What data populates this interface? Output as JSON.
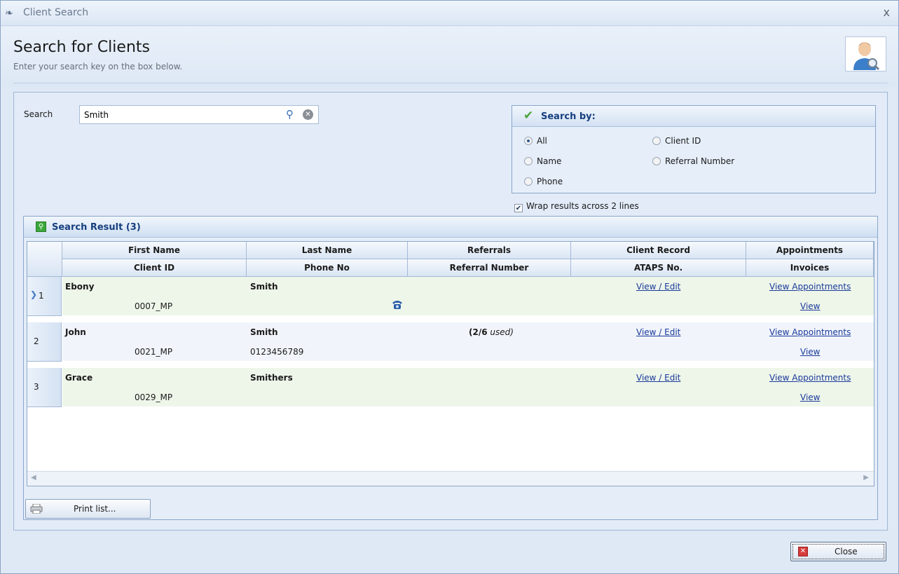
{
  "window": {
    "title": "Client Search",
    "close_glyph": "x"
  },
  "header": {
    "title": "Search for Clients",
    "subtitle": "Enter your search key on the box below."
  },
  "search": {
    "label": "Search",
    "value": "Smith"
  },
  "search_by": {
    "title": "Search by:",
    "options": [
      {
        "label": "All",
        "selected": true
      },
      {
        "label": "Client ID",
        "selected": false
      },
      {
        "label": "Name",
        "selected": false
      },
      {
        "label": "Referral Number",
        "selected": false
      },
      {
        "label": "Phone",
        "selected": false
      }
    ]
  },
  "wrap_option": {
    "label": "Wrap results across 2 lines",
    "checked": true
  },
  "results": {
    "title": "Search Result (3)",
    "columns_top": [
      "First Name",
      "Last Name",
      "Referrals",
      "Client Record",
      "Appointments"
    ],
    "columns_bottom": [
      "Client ID",
      "Phone No",
      "Referral Number",
      "ATAPS No.",
      "Invoices"
    ],
    "rows": [
      {
        "index": "1",
        "first_name": "Ebony",
        "last_name": "Smith",
        "referrals_count": "",
        "referrals_note": "",
        "client_id": "0007_MP",
        "phone": "",
        "client_record": "View / Edit",
        "appointments": "View Appointments",
        "invoices": "View"
      },
      {
        "index": "2",
        "first_name": "John",
        "last_name": "Smith",
        "referrals_count": "(2/6",
        "referrals_note": "used)",
        "client_id": "0021_MP",
        "phone": "0123456789",
        "client_record": "View / Edit",
        "appointments": "View Appointments",
        "invoices": "View"
      },
      {
        "index": "3",
        "first_name": "Grace",
        "last_name": "Smithers",
        "referrals_count": "",
        "referrals_note": "",
        "client_id": "0029_MP",
        "phone": "",
        "client_record": "View / Edit",
        "appointments": "View Appointments",
        "invoices": "View"
      }
    ]
  },
  "buttons": {
    "print": "Print list...",
    "close": "Close"
  },
  "icons": {
    "app": "bird-icon",
    "avatar": "user-search-icon",
    "search": "magnifier-icon",
    "clear": "clear-icon",
    "check": "checkmark-icon",
    "results": "results-icon",
    "phone": "phone-icon",
    "printer": "printer-icon",
    "close": "close-icon"
  },
  "colors": {
    "accent": "#163f7e",
    "link": "#1a3a9a",
    "row_highlight": "#eef6ea"
  }
}
